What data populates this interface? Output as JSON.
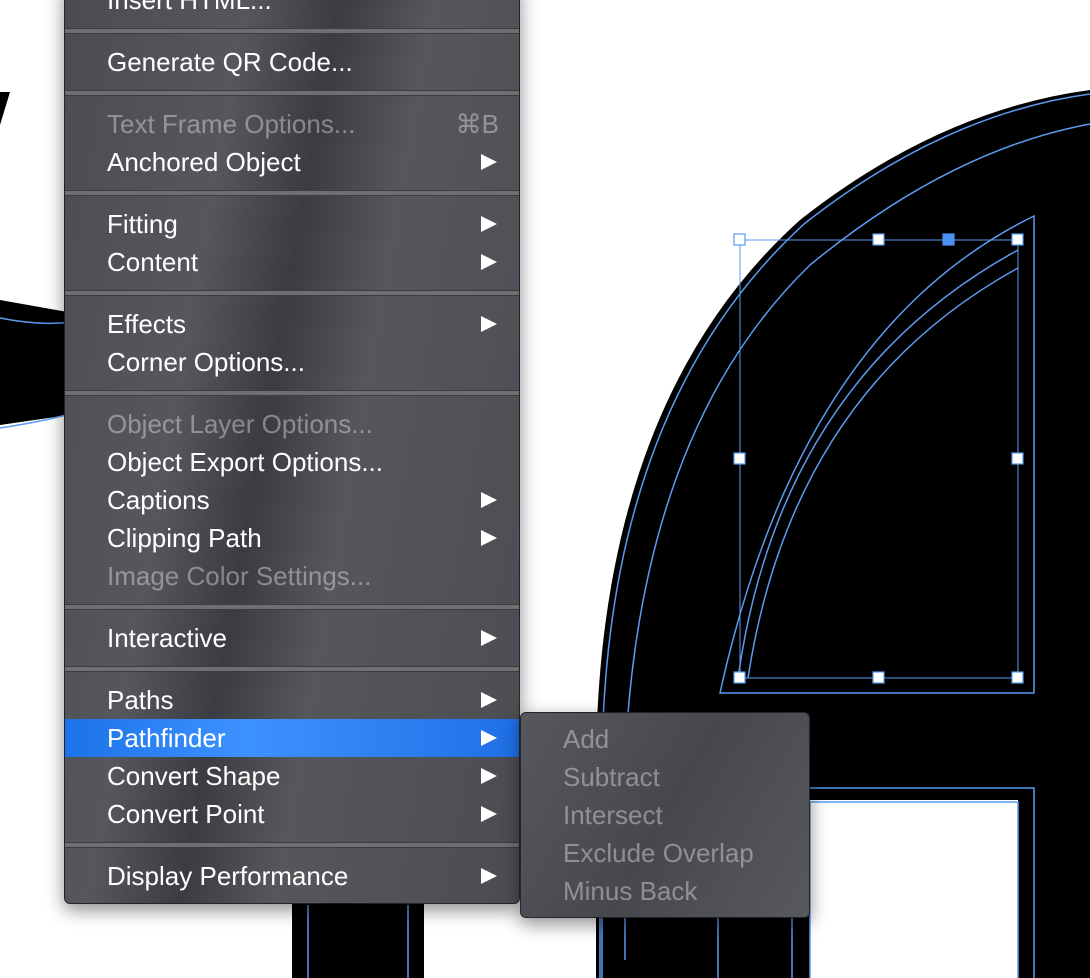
{
  "menu": {
    "items": [
      {
        "label": "Insert HTML...",
        "type": "item",
        "enabled": true
      },
      {
        "type": "separator"
      },
      {
        "label": "Generate QR Code...",
        "type": "item",
        "enabled": true
      },
      {
        "type": "separator"
      },
      {
        "label": "Text Frame Options...",
        "type": "item",
        "enabled": false,
        "shortcut": "⌘B"
      },
      {
        "label": "Anchored Object",
        "type": "item",
        "enabled": true,
        "submenu": true
      },
      {
        "type": "separator"
      },
      {
        "label": "Fitting",
        "type": "item",
        "enabled": true,
        "submenu": true
      },
      {
        "label": "Content",
        "type": "item",
        "enabled": true,
        "submenu": true
      },
      {
        "type": "separator"
      },
      {
        "label": "Effects",
        "type": "item",
        "enabled": true,
        "submenu": true
      },
      {
        "label": "Corner Options...",
        "type": "item",
        "enabled": true
      },
      {
        "type": "separator"
      },
      {
        "label": "Object Layer Options...",
        "type": "item",
        "enabled": false
      },
      {
        "label": "Object Export Options...",
        "type": "item",
        "enabled": true
      },
      {
        "label": "Captions",
        "type": "item",
        "enabled": true,
        "submenu": true
      },
      {
        "label": "Clipping Path",
        "type": "item",
        "enabled": true,
        "submenu": true
      },
      {
        "label": "Image Color Settings...",
        "type": "item",
        "enabled": false
      },
      {
        "type": "separator"
      },
      {
        "label": "Interactive",
        "type": "item",
        "enabled": true,
        "submenu": true
      },
      {
        "type": "separator"
      },
      {
        "label": "Paths",
        "type": "item",
        "enabled": true,
        "submenu": true
      },
      {
        "label": "Pathfinder",
        "type": "item",
        "enabled": true,
        "submenu": true,
        "highlighted": true
      },
      {
        "label": "Convert Shape",
        "type": "item",
        "enabled": true,
        "submenu": true
      },
      {
        "label": "Convert Point",
        "type": "item",
        "enabled": true,
        "submenu": true
      },
      {
        "type": "separator"
      },
      {
        "label": "Display Performance",
        "type": "item",
        "enabled": true,
        "submenu": true
      }
    ]
  },
  "submenu": {
    "parent": "Pathfinder",
    "items": [
      {
        "label": "Add",
        "enabled": false
      },
      {
        "label": "Subtract",
        "enabled": false
      },
      {
        "label": "Intersect",
        "enabled": false
      },
      {
        "label": "Exclude Overlap",
        "enabled": false
      },
      {
        "label": "Minus Back",
        "enabled": false
      }
    ]
  },
  "colors": {
    "highlight": "#1a73e8",
    "frame_edge": "#5b9bf0",
    "selected_handle": "#4a90f0",
    "artwork": "#000000"
  }
}
